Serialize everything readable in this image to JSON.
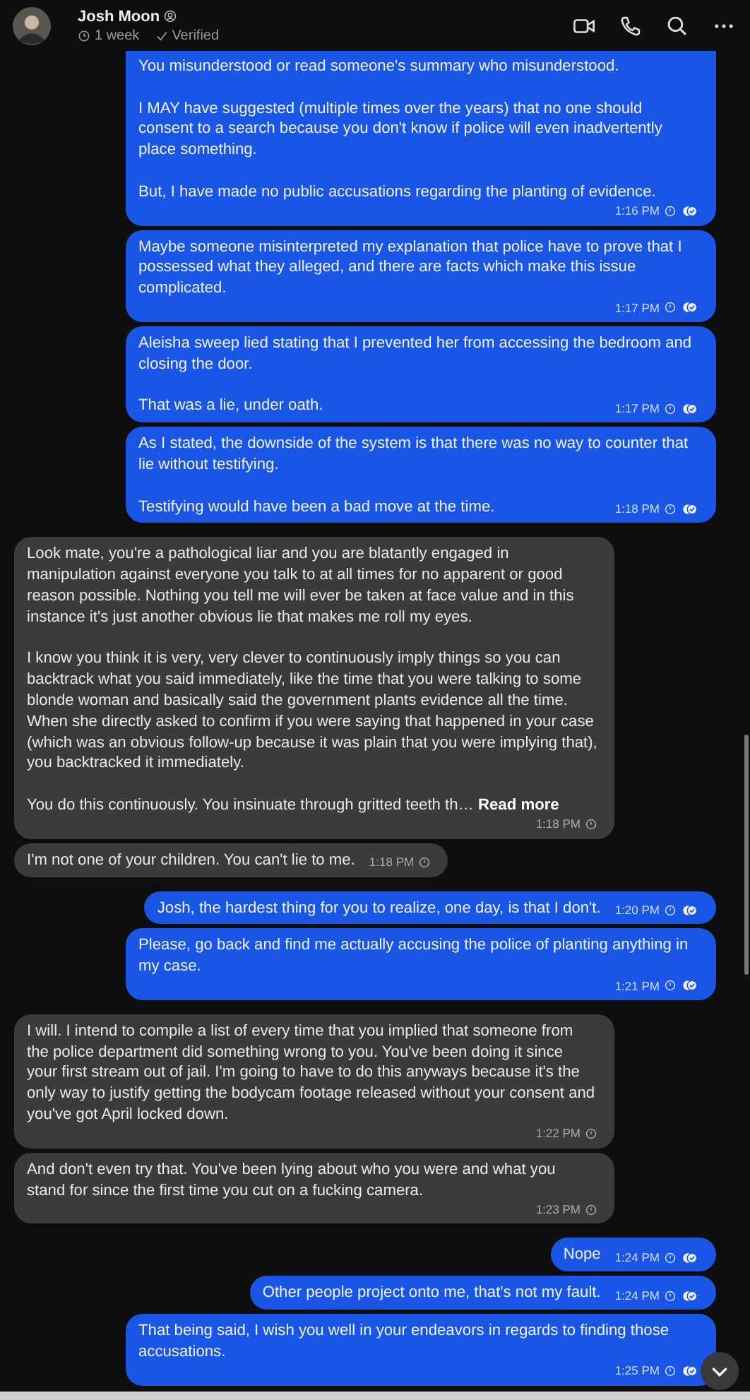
{
  "header": {
    "contact_name": "Josh Moon",
    "last_seen": "1 week",
    "verified_label": "Verified"
  },
  "messages": [
    {
      "kind": "outgoing",
      "paragraphs": [
        "You misunderstood or read someone's summary who misunderstood.",
        "I MAY have suggested (multiple times over the years) that no one should consent to a search because you don't know if police will even inadvertently place something.",
        "But, I have made no public accusations regarding the planting of evidence."
      ],
      "time": "1:16 PM"
    },
    {
      "kind": "outgoing",
      "paragraphs": [
        "Maybe someone misinterpreted my explanation that police have to prove that I possessed what they alleged, and there are facts which make this issue complicated."
      ],
      "time": "1:17 PM"
    },
    {
      "kind": "outgoing",
      "paragraphs": [
        "Aleisha sweep lied stating that I prevented her from accessing the bedroom and closing the door.",
        "That was a lie, under oath."
      ],
      "time": "1:17 PM"
    },
    {
      "kind": "outgoing",
      "paragraphs": [
        "As I stated, the downside of the system is that there was no way to counter that lie without testifying.",
        "Testifying would have been a bad move at the time."
      ],
      "time": "1:18 PM"
    },
    {
      "kind": "incoming",
      "paragraphs": [
        "Look mate, you're a pathological liar and you are blatantly engaged in manipulation against everyone you talk to at all times for no apparent or good reason possible. Nothing you tell me will ever be taken at face value and in this instance it's just another obvious lie that makes me roll my eyes.",
        "I know you think it is very, very clever to continuously imply things so you can backtrack what you said immediately, like the time that you were talking to some blonde woman and basically said the government plants evidence all the time. When she directly asked to confirm if you were saying that happened in your case (which was an obvious follow-up because it was plain that you were implying that), you backtracked it immediately.",
        "You do this continuously. You insinuate through gritted teeth th…"
      ],
      "read_more": "Read more",
      "time": "1:18 PM"
    },
    {
      "kind": "incoming",
      "paragraphs": [
        "I'm not one of your children. You can't lie to me."
      ],
      "time": "1:18 PM"
    },
    {
      "kind": "outgoing",
      "paragraphs": [
        "Josh, the hardest thing for you to realize, one day, is that I don't."
      ],
      "time": "1:20 PM"
    },
    {
      "kind": "outgoing",
      "paragraphs": [
        "Please, go back and find me actually accusing the police of planting anything in my case."
      ],
      "time": "1:21 PM"
    },
    {
      "kind": "incoming",
      "paragraphs": [
        "I will. I intend to compile a list of every time that you implied that someone from the police department did something wrong to you. You've been doing it since your first stream out of jail. I'm going to have to do this anyways because it's the only way to justify getting the bodycam footage released without your consent and you've got April locked down."
      ],
      "time": "1:22 PM"
    },
    {
      "kind": "incoming",
      "paragraphs": [
        "And don't even try that. You've been lying about who you were and what you stand for since the first time you cut on a fucking camera."
      ],
      "time": "1:23 PM"
    },
    {
      "kind": "outgoing",
      "paragraphs": [
        "Nope"
      ],
      "time": "1:24 PM"
    },
    {
      "kind": "outgoing",
      "paragraphs": [
        "Other people project onto me, that's not my fault."
      ],
      "time": "1:24 PM"
    },
    {
      "kind": "outgoing",
      "paragraphs": [
        "That being said, I wish you well in your endeavors in regards to finding those accusations."
      ],
      "time": "1:25 PM"
    }
  ]
}
